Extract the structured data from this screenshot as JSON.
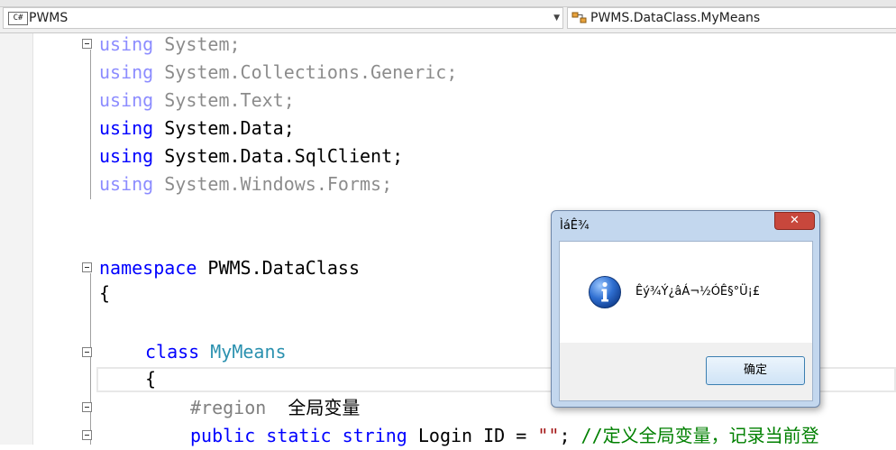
{
  "navbar": {
    "project_combo": {
      "icon_label": "C#",
      "text": "PWMS",
      "dropdown_glyph": "▼"
    },
    "member_combo": {
      "text": "PWMS.DataClass.MyMeans"
    }
  },
  "code": {
    "line1": {
      "kw": "using",
      "rest": " System;"
    },
    "line2": {
      "kw": "using",
      "rest": " System.Collections.Generic;"
    },
    "line3": {
      "kw": "using",
      "rest": " System.Text;"
    },
    "line4": {
      "kw": "using",
      "rest": " System.Data;"
    },
    "line5": {
      "kw": "using",
      "rest": " System.Data.SqlClient;"
    },
    "line6": {
      "kw": "using",
      "rest": " System.Windows.Forms;"
    },
    "line7": {
      "kw": "namespace",
      "rest": " PWMS.DataClass"
    },
    "line8": {
      "text": "{"
    },
    "line9": {
      "kw": "class",
      "type": "MyMeans"
    },
    "line10": {
      "text": "{"
    },
    "line11": {
      "region": "#region",
      "rest": "  全局变量"
    },
    "line12": {
      "kw1": "public",
      "kw2": "static",
      "kw3": "string",
      "name": " Login ID = ",
      "str": "\"\"",
      "semi": "; ",
      "comment": "//定义全局变量，记录当前登"
    }
  },
  "dialog": {
    "title": "ÌáÊ¾",
    "close_glyph": "✕",
    "message": "Êý¾Ý¿âÁ¬½ÓÊ§°Ü¡£",
    "ok_label": "确定"
  }
}
